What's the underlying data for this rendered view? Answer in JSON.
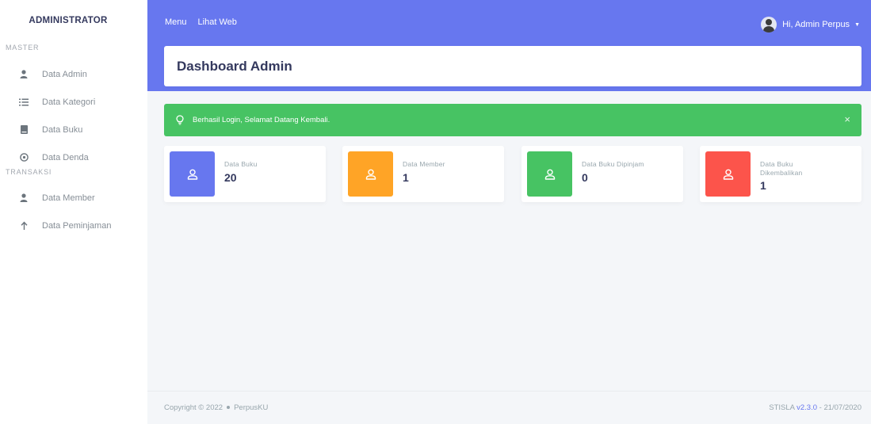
{
  "sidebar": {
    "brand": "ADMINISTRATOR",
    "headers": {
      "master": "MASTER",
      "transaksi": "TRANSAKSI"
    },
    "items": [
      {
        "label": "Data Admin",
        "icon": "user-icon"
      },
      {
        "label": "Data Kategori",
        "icon": "list-icon"
      },
      {
        "label": "Data Buku",
        "icon": "book-icon"
      },
      {
        "label": "Data Denda",
        "icon": "dollar-circle-icon"
      },
      {
        "label": "Data Member",
        "icon": "user-icon"
      },
      {
        "label": "Data Peminjaman",
        "icon": "arrow-up-icon"
      }
    ]
  },
  "topnav": {
    "menu": "Menu",
    "lihat_web": "Lihat Web"
  },
  "user": {
    "greeting": "Hi, Admin Perpus"
  },
  "page": {
    "title": "Dashboard Admin"
  },
  "alert": {
    "message": "Berhasil Login, Selamat Datang Kembali.",
    "close": "×",
    "color": "#47c363"
  },
  "stats": [
    {
      "label": "Data Buku",
      "value": "20",
      "color": "#6777ef"
    },
    {
      "label": "Data Member",
      "value": "1",
      "color": "#ffa426"
    },
    {
      "label": "Data Buku Dipinjam",
      "value": "0",
      "color": "#47c363"
    },
    {
      "label": "Data Buku Dikembalikan",
      "value": "1",
      "color": "#fc544b"
    }
  ],
  "footer": {
    "copyright": "Copyright © 2022",
    "brand": "PerpusKU",
    "stisla": "STISLA",
    "version": "v2.3.0",
    "date": "- 21/07/2020"
  },
  "theme": {
    "primary": "#6777ef",
    "background": "#f4f6f9"
  }
}
